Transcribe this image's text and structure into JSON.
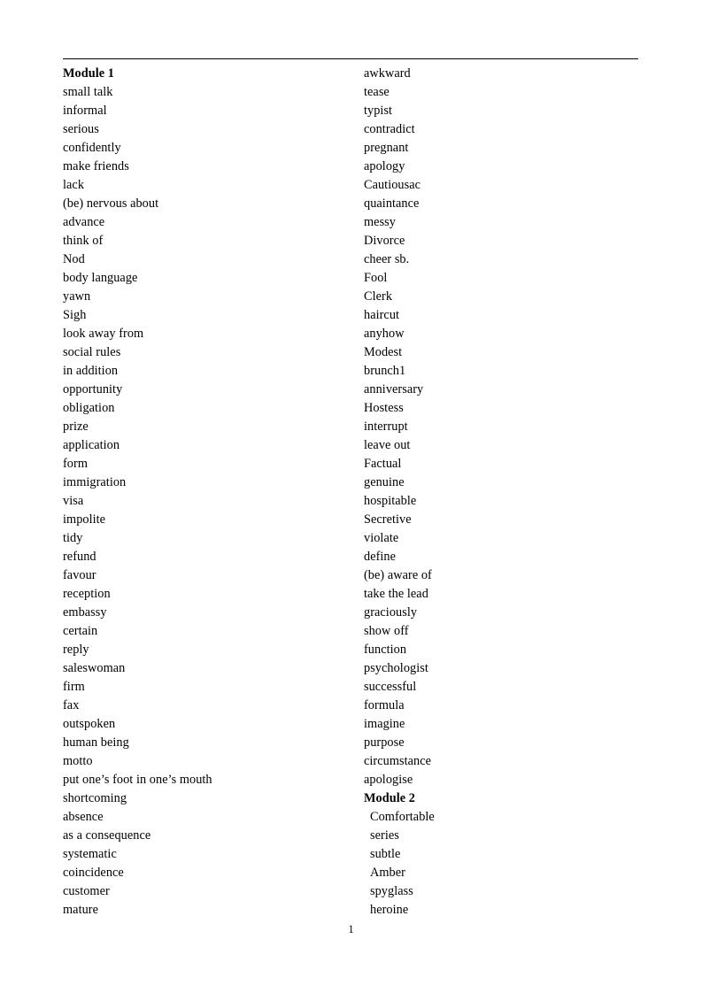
{
  "document": {
    "page_number": "1",
    "has_top_rule": true,
    "text_color": "#000000",
    "background_color": "#ffffff"
  },
  "left_column": [
    {
      "text": "Module 1",
      "style": "heading",
      "indent": false
    },
    {
      "text": "small talk",
      "style": "normal",
      "indent": false
    },
    {
      "text": "informal",
      "style": "normal",
      "indent": false
    },
    {
      "text": "serious",
      "style": "normal",
      "indent": false
    },
    {
      "text": "confidently",
      "style": "normal",
      "indent": false
    },
    {
      "text": "make friends",
      "style": "normal",
      "indent": false
    },
    {
      "text": "lack",
      "style": "normal",
      "indent": false
    },
    {
      "text": "(be) nervous about",
      "style": "normal",
      "indent": false
    },
    {
      "text": "advance",
      "style": "normal",
      "indent": false
    },
    {
      "text": "think of",
      "style": "normal",
      "indent": false
    },
    {
      "text": "Nod",
      "style": "normal",
      "indent": false
    },
    {
      "text": "body language",
      "style": "normal",
      "indent": false
    },
    {
      "text": "yawn",
      "style": "normal",
      "indent": false
    },
    {
      "text": "Sigh",
      "style": "normal",
      "indent": false
    },
    {
      "text": "look away from",
      "style": "normal",
      "indent": false
    },
    {
      "text": "social rules",
      "style": "normal",
      "indent": false
    },
    {
      "text": "in addition",
      "style": "normal",
      "indent": false
    },
    {
      "text": "opportunity",
      "style": "normal",
      "indent": false
    },
    {
      "text": "obligation",
      "style": "normal",
      "indent": false
    },
    {
      "text": "prize",
      "style": "normal",
      "indent": false
    },
    {
      "text": "application",
      "style": "normal",
      "indent": false
    },
    {
      "text": "form",
      "style": "normal",
      "indent": false
    },
    {
      "text": "immigration",
      "style": "normal",
      "indent": false
    },
    {
      "text": "visa",
      "style": "normal",
      "indent": false
    },
    {
      "text": "impolite",
      "style": "normal",
      "indent": false
    },
    {
      "text": "tidy",
      "style": "normal",
      "indent": false
    },
    {
      "text": "refund",
      "style": "normal",
      "indent": false
    },
    {
      "text": "favour",
      "style": "normal",
      "indent": false
    },
    {
      "text": "reception",
      "style": "normal",
      "indent": false
    },
    {
      "text": "embassy",
      "style": "normal",
      "indent": false
    },
    {
      "text": "certain",
      "style": "normal",
      "indent": false
    },
    {
      "text": "reply",
      "style": "normal",
      "indent": false
    },
    {
      "text": "saleswoman",
      "style": "normal",
      "indent": false
    },
    {
      "text": "firm",
      "style": "normal",
      "indent": false
    },
    {
      "text": "fax",
      "style": "normal",
      "indent": false
    },
    {
      "text": "outspoken",
      "style": "normal",
      "indent": false
    },
    {
      "text": "human being",
      "style": "normal",
      "indent": false
    },
    {
      "text": "motto",
      "style": "normal",
      "indent": false
    },
    {
      "text": "put one’s foot in one’s mouth",
      "style": "normal",
      "indent": false
    },
    {
      "text": "shortcoming",
      "style": "normal",
      "indent": false
    },
    {
      "text": "absence",
      "style": "normal",
      "indent": false
    },
    {
      "text": "as a consequence",
      "style": "normal",
      "indent": false
    },
    {
      "text": "systematic",
      "style": "normal",
      "indent": false
    },
    {
      "text": "coincidence",
      "style": "normal",
      "indent": false
    },
    {
      "text": "customer",
      "style": "normal",
      "indent": false
    },
    {
      "text": "mature",
      "style": "normal",
      "indent": false
    }
  ],
  "right_column": [
    {
      "text": "awkward",
      "style": "normal",
      "indent": false
    },
    {
      "text": "tease",
      "style": "normal",
      "indent": false
    },
    {
      "text": "typist",
      "style": "normal",
      "indent": false
    },
    {
      "text": "contradict",
      "style": "normal",
      "indent": false
    },
    {
      "text": "pregnant",
      "style": "normal",
      "indent": false
    },
    {
      "text": "apology",
      "style": "normal",
      "indent": false
    },
    {
      "text": "Cautiousac",
      "style": "normal",
      "indent": false
    },
    {
      "text": "quaintance",
      "style": "normal",
      "indent": false
    },
    {
      "text": "messy",
      "style": "normal",
      "indent": false
    },
    {
      "text": "Divorce",
      "style": "normal",
      "indent": false
    },
    {
      "text": "cheer sb.",
      "style": "normal",
      "indent": false
    },
    {
      "text": "Fool",
      "style": "normal",
      "indent": false
    },
    {
      "text": "Clerk",
      "style": "normal",
      "indent": false
    },
    {
      "text": "haircut",
      "style": "normal",
      "indent": false
    },
    {
      "text": "anyhow",
      "style": "normal",
      "indent": false
    },
    {
      "text": "Modest",
      "style": "normal",
      "indent": false
    },
    {
      "text": "brunch1",
      "style": "normal",
      "indent": false
    },
    {
      "text": "anniversary",
      "style": "normal",
      "indent": false
    },
    {
      "text": "Hostess",
      "style": "normal",
      "indent": false
    },
    {
      "text": "interrupt",
      "style": "normal",
      "indent": false
    },
    {
      "text": "leave out",
      "style": "normal",
      "indent": false
    },
    {
      "text": "Factual",
      "style": "normal",
      "indent": false
    },
    {
      "text": "genuine",
      "style": "normal",
      "indent": false
    },
    {
      "text": "hospitable",
      "style": "normal",
      "indent": false
    },
    {
      "text": "Secretive",
      "style": "normal",
      "indent": false
    },
    {
      "text": "violate",
      "style": "normal",
      "indent": false
    },
    {
      "text": "define",
      "style": "normal",
      "indent": false
    },
    {
      "text": "(be) aware of",
      "style": "normal",
      "indent": false
    },
    {
      "text": "take the lead",
      "style": "normal",
      "indent": false
    },
    {
      "text": "graciously",
      "style": "normal",
      "indent": false
    },
    {
      "text": "show off",
      "style": "normal",
      "indent": false
    },
    {
      "text": "function",
      "style": "normal",
      "indent": false
    },
    {
      "text": "psychologist",
      "style": "normal",
      "indent": false
    },
    {
      "text": "successful",
      "style": "normal",
      "indent": false
    },
    {
      "text": "formula",
      "style": "normal",
      "indent": false
    },
    {
      "text": "imagine",
      "style": "normal",
      "indent": false
    },
    {
      "text": "purpose",
      "style": "normal",
      "indent": false
    },
    {
      "text": "circumstance",
      "style": "normal",
      "indent": false
    },
    {
      "text": "apologise",
      "style": "normal",
      "indent": false
    },
    {
      "text": "Module 2",
      "style": "heading",
      "indent": false
    },
    {
      "text": "Comfortable",
      "style": "normal",
      "indent": true
    },
    {
      "text": "series",
      "style": "normal",
      "indent": true
    },
    {
      "text": "subtle",
      "style": "normal",
      "indent": true
    },
    {
      "text": "Amber",
      "style": "normal",
      "indent": true
    },
    {
      "text": "spyglass",
      "style": "normal",
      "indent": true
    },
    {
      "text": "heroine",
      "style": "normal",
      "indent": true
    }
  ]
}
